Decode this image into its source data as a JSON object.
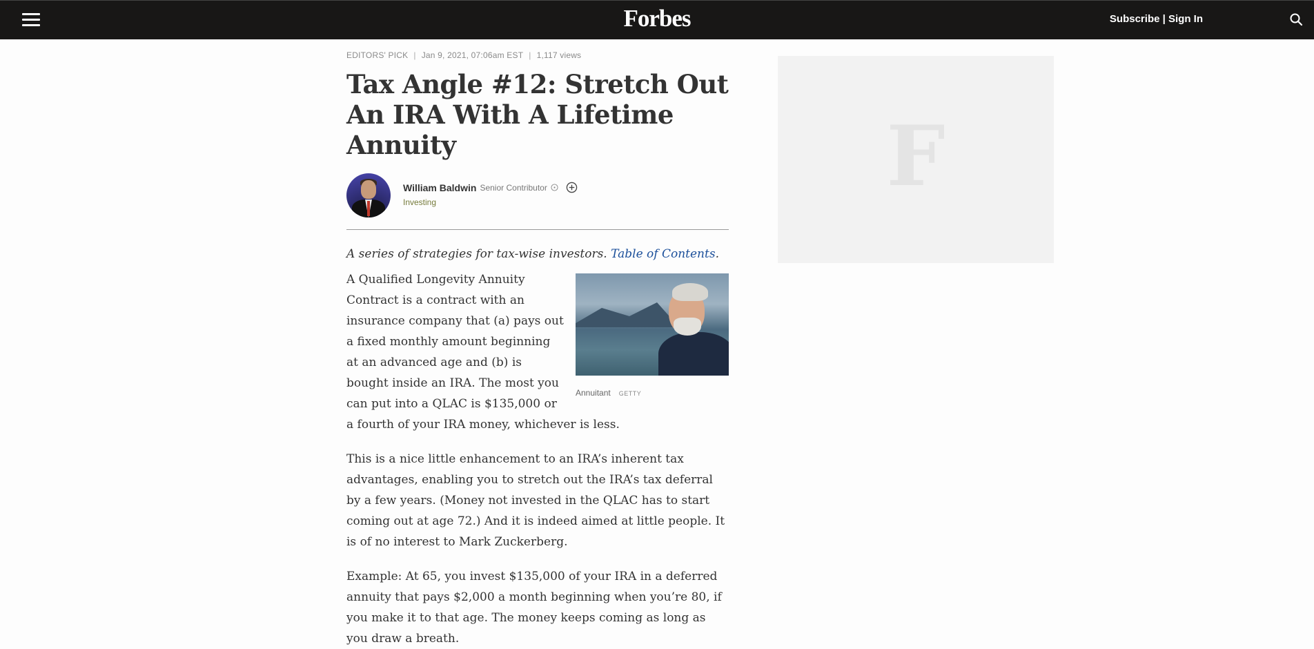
{
  "header": {
    "logo": "Forbes",
    "subscribe_label": "Subscribe",
    "separator": "|",
    "signin_label": "Sign In"
  },
  "article": {
    "meta": {
      "badge": "EDITORS' PICK",
      "date": "Jan 9, 2021, 07:06am EST",
      "views": "1,117 views"
    },
    "title": "Tax Angle #12: Stretch Out An IRA With A Lifetime Annuity",
    "author": {
      "name": "William Baldwin",
      "role": "Senior Contributor",
      "channel": "Investing"
    },
    "intro_text": "A series of strategies for tax-wise investors. ",
    "intro_link": "Table of Contents",
    "intro_end": ".",
    "figure": {
      "caption": "Annuitant",
      "credit": "GETTY"
    },
    "paragraphs": [
      "A Qualified Longevity Annuity Contract is a contract with an insurance company that (a) pays out a fixed monthly amount beginning at an advanced age and (b) is bought inside an IRA. The most you can put into a QLAC is $135,000 or a fourth of your IRA money, whichever is less.",
      "This is a nice little enhancement to an IRA’s inherent tax advantages, enabling you to stretch out the IRA’s tax deferral by a few years. (Money not invested in the QLAC has to start coming out at age 72.) And it is indeed aimed at little people. It is of no interest to Mark Zuckerberg.",
      "Example: At 65, you invest $135,000 of your IRA in a deferred annuity that pays $2,000 a month beginning when you’re 80, if you make it to that age. The money keeps coming as long as you draw a breath."
    ]
  },
  "sidebar": {
    "ad_glyph": "F"
  },
  "colors": {
    "topbar": "#181716",
    "link": "#1b4f9a",
    "channel": "#767b3b"
  }
}
